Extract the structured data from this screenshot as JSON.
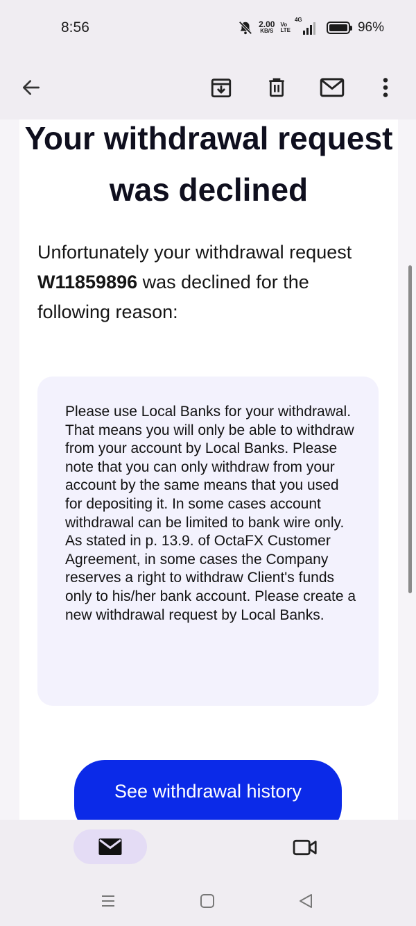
{
  "status_bar": {
    "time": "8:56",
    "net_speed_value": "2.00",
    "net_speed_unit": "KB/S",
    "volte_top": "Vo",
    "volte_bottom": "LTE",
    "network": "4G",
    "battery": "96%"
  },
  "toolbar": {
    "back_icon": "arrow-left-icon",
    "archive_icon": "archive-icon",
    "delete_icon": "trash-icon",
    "mark_unread_icon": "mail-icon",
    "more_icon": "more-vertical-icon"
  },
  "email": {
    "heading": "Your withdrawal request was declined",
    "intro_before": "Unfortunately your withdrawal request ",
    "request_id": "W11859896",
    "intro_after": " was declined for the following reason:",
    "reason": "Please use Local Banks for your withdrawal. That means you will only be able to withdraw from your account by Local Banks. Please note that you can only withdraw from your account by the same means that you used for depositing it. In some cases account withdrawal can be limited to bank wire only. As stated in p. 13.9. of OctaFX Customer Agreement, in some cases the Company reserves a right to withdraw Client's funds only to his/her bank account. Please create a new withdrawal request by Local Banks.",
    "cta_label": "See withdrawal history"
  },
  "bottom_nav": {
    "mail_icon": "mail-icon",
    "meet_icon": "video-icon"
  },
  "system_nav": {
    "recents_icon": "menu-icon",
    "home_icon": "square-icon",
    "back_icon": "triangle-back-icon"
  },
  "colors": {
    "accent": "#0b2ae8",
    "reason_bg": "#f3f2fd",
    "chrome_bg": "#f0edf2",
    "active_pill": "#e4dcf5"
  }
}
